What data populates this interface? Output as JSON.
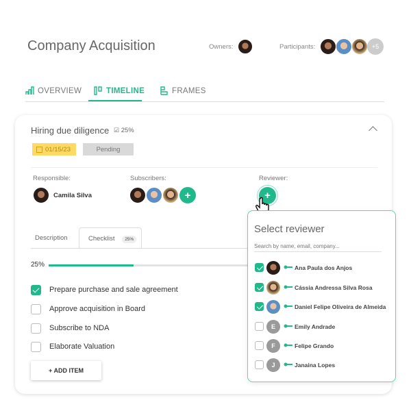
{
  "header": {
    "title": "Company Acquisition",
    "owners_label": "Owners:",
    "participants_label": "Participants:",
    "participants_more": "+5"
  },
  "tabs": [
    {
      "label": "OVERVIEW",
      "icon": "bar-chart-icon"
    },
    {
      "label": "TIMELINE",
      "icon": "timeline-icon",
      "active": true
    },
    {
      "label": "FRAMES",
      "icon": "frames-icon"
    }
  ],
  "card": {
    "title": "Hiring due diligence",
    "progress_label": "25%",
    "date": "01/15/23",
    "status": "Pending",
    "responsible_label": "Responsible:",
    "responsible_name": "Camila Silva",
    "subscribers_label": "Subscribers:",
    "reviewer_label": "Reviewer:",
    "subtabs": [
      {
        "label": "Description"
      },
      {
        "label": "Checklist",
        "badge": "25%",
        "active": true
      }
    ],
    "checklist_progress": "25%",
    "checklist_progress_value": 25,
    "items": [
      {
        "label": "Prepare purchase and sale agreement",
        "checked": true
      },
      {
        "label": "Approve acquisition in Board",
        "checked": false
      },
      {
        "label": "Subscribe to NDA",
        "checked": false
      },
      {
        "label": "Elaborate Valuation",
        "checked": false
      }
    ],
    "add_item": "+ ADD ITEM"
  },
  "reviewer_popup": {
    "title": "Select reviewer",
    "search_placeholder": "Search by name, email, company...",
    "people": [
      {
        "name": "Ana Paula dos Anjos",
        "checked": true
      },
      {
        "name": "Cássia Andressa Silva Rosa",
        "checked": true
      },
      {
        "name": "Daniel Felipe Oliveira de Almeida",
        "checked": true
      },
      {
        "name": "Emily Andrade",
        "initial": "E",
        "checked": false
      },
      {
        "name": "Felipe Grando",
        "initial": "F",
        "checked": false
      },
      {
        "name": "Janaina Lopes",
        "initial": "J",
        "checked": false
      }
    ]
  },
  "colors": {
    "accent": "#21b98b",
    "date_badge": "#ffd966",
    "status_badge": "#d9d9d9"
  }
}
